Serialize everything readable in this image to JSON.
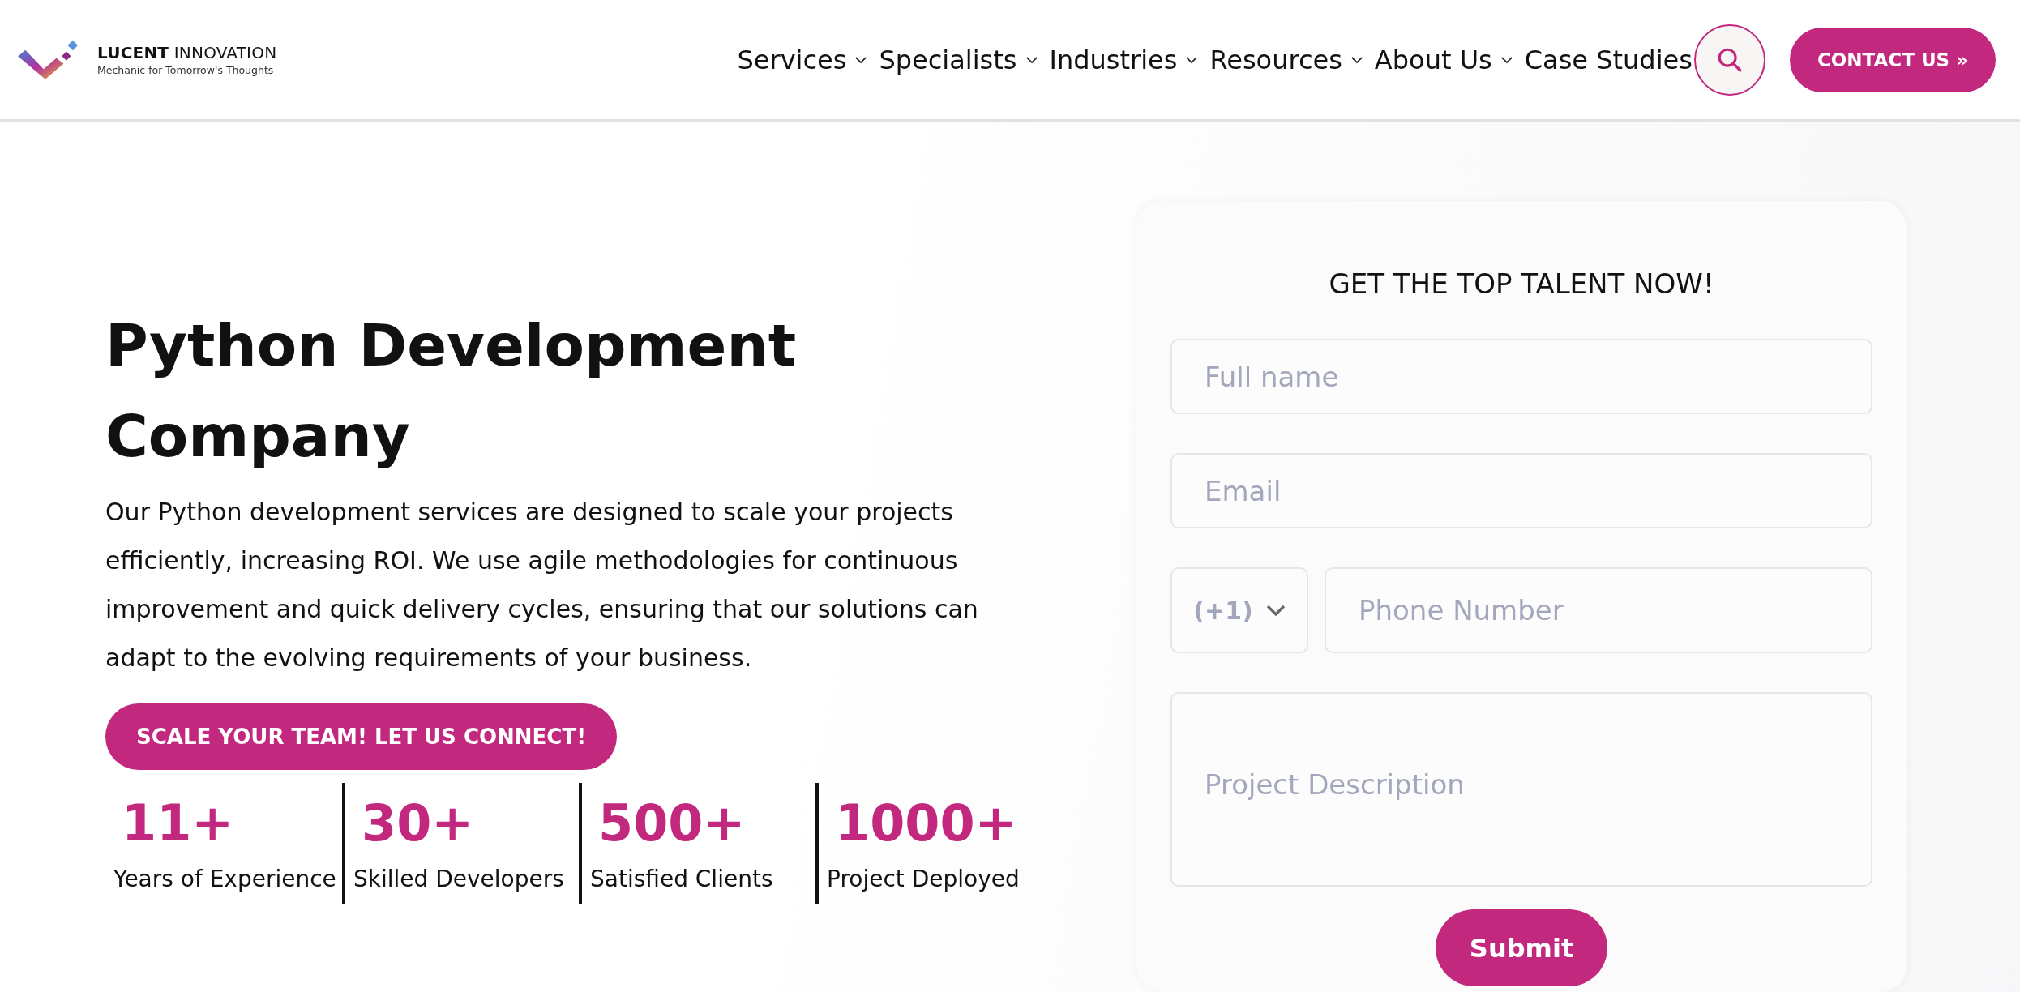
{
  "header": {
    "logo": {
      "name": "LUCENT",
      "name_rest": "INNOVATION",
      "tagline": "Mechanic for Tomorrow's Thoughts"
    },
    "nav": [
      {
        "label": "Services",
        "has_dropdown": true
      },
      {
        "label": "Specialists",
        "has_dropdown": true
      },
      {
        "label": "Industries",
        "has_dropdown": true
      },
      {
        "label": "Resources",
        "has_dropdown": true
      },
      {
        "label": "About Us",
        "has_dropdown": true
      },
      {
        "label": "Case Studies",
        "has_dropdown": false
      }
    ],
    "contact_button": "CONTACT US »"
  },
  "hero": {
    "title": "Python Development Company",
    "description": "Our Python development services are designed to scale your projects efficiently, increasing ROI. We use agile methodologies for continuous improvement and quick delivery cycles, ensuring that our solutions can adapt to the evolving requirements of your business.",
    "cta": "SCALE YOUR TEAM! LET US CONNECT!",
    "stats": [
      {
        "value": "11+",
        "label": "Years of Experience"
      },
      {
        "value": "30+",
        "label": "Skilled Developers"
      },
      {
        "value": "500+",
        "label": "Satisfied Clients"
      },
      {
        "value": "1000+",
        "label": "Project Deployed"
      }
    ]
  },
  "form": {
    "title": "GET THE TOP TALENT NOW!",
    "full_name": {
      "placeholder": "Full name"
    },
    "email": {
      "placeholder": "Email"
    },
    "country_code": "(+1)",
    "phone": {
      "placeholder": "Phone Number"
    },
    "description": {
      "placeholder": "Project Description"
    },
    "submit": "Submit"
  }
}
